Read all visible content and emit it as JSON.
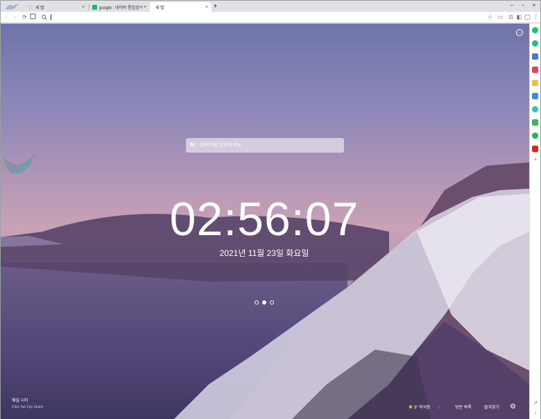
{
  "tabs": [
    {
      "title": "새 탭",
      "active": false,
      "favicon": "whale-icon"
    },
    {
      "title": "google : 네이버 통합검색",
      "active": false,
      "favicon": "naver-icon"
    },
    {
      "title": "새 탭",
      "active": true,
      "favicon": "none"
    }
  ],
  "toolbar": {
    "address_value": "",
    "address_placeholder": ""
  },
  "search": {
    "placeholder": "검색어를 입력하세요"
  },
  "clock": {
    "time": "02:56:07",
    "date": "2021년 11월 23일 화요일"
  },
  "carousel": {
    "count": 3,
    "active_index": 1
  },
  "photo": {
    "title": "웨일 시티",
    "subtitle": "Click Tab City Select"
  },
  "weather": {
    "temperature": "3°",
    "location": "옥석동"
  },
  "bottom_links": {
    "most_visited": "방문 목록",
    "shortcuts": "즐겨찾기"
  },
  "colors": {
    "naver_green": "#03c75a",
    "sky_top": "#6f74a8",
    "sky_mid": "#c9a2b5"
  },
  "sidebar_icons": [
    "green-plus-icon",
    "green-circle-icon",
    "blue-square-icon",
    "red-pocket-icon",
    "yellow-icon",
    "blue-e-icon",
    "teal-icon",
    "green-calendar-icon",
    "green-music-icon",
    "red-youtube-icon",
    "add-icon"
  ]
}
